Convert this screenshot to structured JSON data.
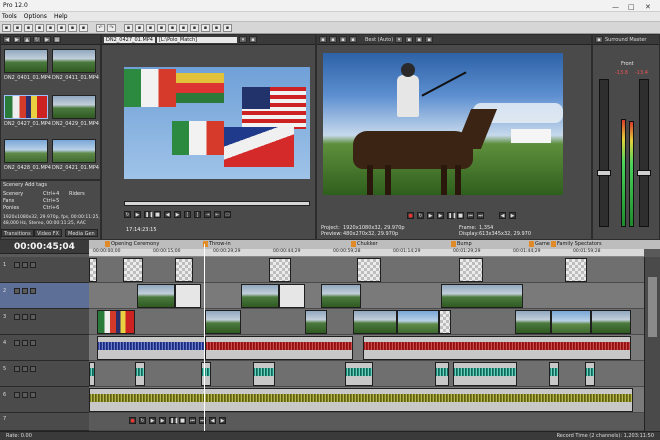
{
  "window": {
    "title": "Pro 12.0"
  },
  "menu": {
    "items": [
      "Tools",
      "Options",
      "Help"
    ]
  },
  "explorer": {
    "clips": [
      {
        "label": "DN2_0401_01.MP4"
      },
      {
        "label": "DN2_0411_01.MP4"
      },
      {
        "label": "DN2_0427_01.MP4"
      },
      {
        "label": "DN2_0429_01.MP4"
      },
      {
        "label": "DN2_0428_01.MP4"
      },
      {
        "label": "DN2_0421_01.MP4"
      }
    ]
  },
  "media_list": {
    "header": "Scenery   Add tags",
    "rows": [
      {
        "name": "Scenery",
        "key": "Ctrl+4",
        "tag": "Riders"
      },
      {
        "name": "Fans",
        "key": "Ctrl+5",
        "tag": ""
      },
      {
        "name": "Ponies",
        "key": "Ctrl+6",
        "tag": ""
      }
    ],
    "info": "1920x1080x32, 29.970p, fps, 00:00:11:25, Alpha = ...",
    "info2": "48,000 Hz, Stereo, 00:00:11:25, AAC",
    "tabs": [
      "Transitions",
      "Video FX",
      "Media Gen"
    ]
  },
  "trimmer": {
    "file": "DN2_0427_01.MP4",
    "path": "[L:\\Polo_Match]",
    "timecode": "17:14:23:15"
  },
  "preview": {
    "quality": "Best (Auto)",
    "project_label": "Project:",
    "project": "1920x1080x32, 29.970p",
    "preview_label": "Preview:",
    "preview_val": "480x270x32, 29.970p",
    "frame_label": "Frame:",
    "frame": "1,354",
    "display_label": "Display:",
    "display": "613x345x32, 29.970"
  },
  "master": {
    "title": "Surround Master",
    "sub": "Front",
    "levels": [
      "-13.8",
      "-13.4"
    ]
  },
  "timeline": {
    "timecode": "00:00:45;04",
    "markers": [
      {
        "n": "1",
        "label": "Opening Ceremony"
      },
      {
        "n": "2",
        "label": "Throw-in"
      },
      {
        "n": "3",
        "label": "Chukker"
      },
      {
        "n": "4",
        "label": "Bump"
      },
      {
        "n": "5",
        "label": "Game"
      },
      {
        "n": "6",
        "label": "Family Spectators"
      }
    ],
    "ticks": [
      "00:00:00;00",
      "00:00:15;00",
      "00:00:29;29",
      "00:00:44;29",
      "00:00:59;28",
      "00:01:14;29",
      "00:01:29;29",
      "00:01:44;29",
      "00:01:59;28"
    ],
    "tracks": [
      "1",
      "2",
      "3",
      "4",
      "5",
      "6",
      "7"
    ]
  },
  "status": {
    "rate": "Rate: 0.00",
    "record": "Record Time (2 channels): 1,203:11:50"
  }
}
